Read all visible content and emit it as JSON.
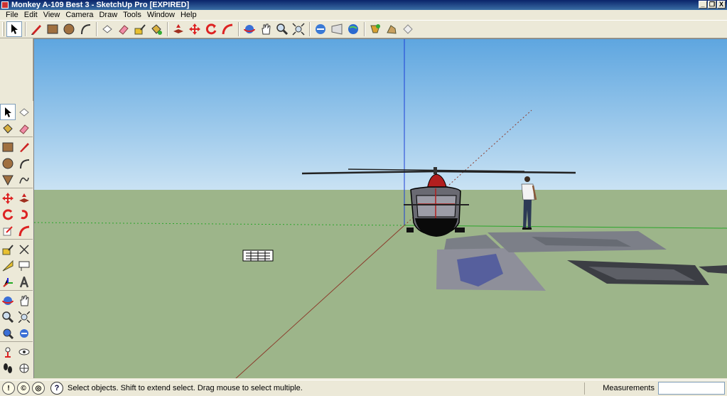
{
  "window": {
    "title": "Monkey A-109 Best 3 - SketchUp Pro [EXPIRED]",
    "controls": [
      "_",
      "❐",
      "X"
    ]
  },
  "menu": [
    "File",
    "Edit",
    "View",
    "Camera",
    "Draw",
    "Tools",
    "Window",
    "Help"
  ],
  "toolbar": {
    "tools": [
      "select-tool",
      "line-tool",
      "rectangle-tool",
      "circle-tool",
      "arc-tool",
      "make-component-tool",
      "eraser-tool",
      "tape-measure-tool",
      "paint-bucket-tool",
      "push-pull-tool",
      "move-tool",
      "rotate-tool",
      "follow-me-tool",
      "orbit-tool",
      "pan-tool",
      "zoom-tool",
      "zoom-extents-tool",
      "get-models-tool",
      "share-model-tool",
      "3d-warehouse-tool",
      "get-photo-texture-tool",
      "export-texture-tool",
      "preview-google-earth-tool"
    ]
  },
  "left_toolbar": {
    "tools": [
      "select",
      "make-component",
      "paint-bucket",
      "eraser",
      "rectangle",
      "line",
      "circle",
      "arc",
      "polygon",
      "freehand",
      "move",
      "push-pull",
      "rotate",
      "follow-me",
      "scale",
      "offset",
      "tape-measure",
      "dimension",
      "protractor",
      "text",
      "axes",
      "3d-text",
      "orbit",
      "pan",
      "zoom",
      "zoom-window",
      "zoom-extents",
      "previous-view",
      "position-camera",
      "look-around",
      "walk",
      "section-plane"
    ]
  },
  "status": {
    "message": "Select objects. Shift to extend select. Drag mouse to select multiple.",
    "measurements_label": "Measurements",
    "measurements_value": ""
  },
  "colors": {
    "sky_top": "#5ea6e0",
    "sky_bottom": "#c9e2f3",
    "ground": "#9db58a",
    "blue_axis": "#1c3fd6",
    "red_axis": "#8b3b2b",
    "green_axis": "#2aa52a"
  }
}
